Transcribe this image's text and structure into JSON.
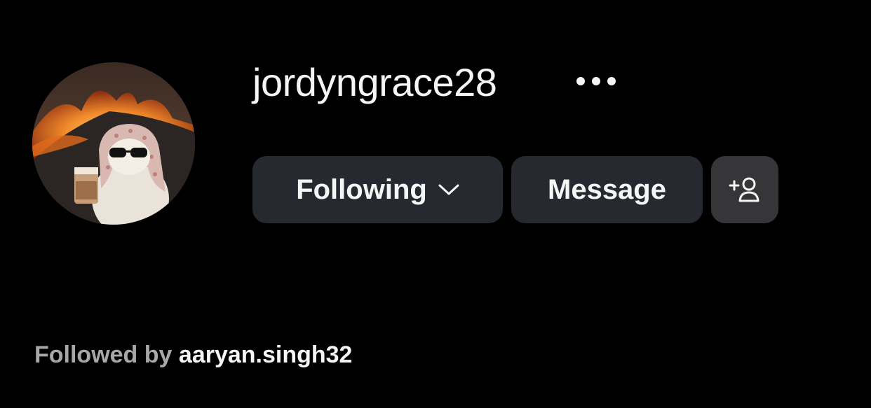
{
  "profile": {
    "username": "jordyngrace28",
    "avatar_icon": "profile-photo-cat-volcano"
  },
  "actions": {
    "more_icon": "ellipsis-icon",
    "following_label": "Following",
    "following_icon": "chevron-down-icon",
    "message_label": "Message",
    "add_user_icon": "add-person-icon"
  },
  "followed_by": {
    "prefix": "Followed by",
    "username": "aaryan.singh32"
  },
  "colors": {
    "background": "#000000",
    "button": "#262a30",
    "add_button": "#363638",
    "text_primary": "#f5f5f5",
    "text_secondary": "#a8a8a8"
  }
}
